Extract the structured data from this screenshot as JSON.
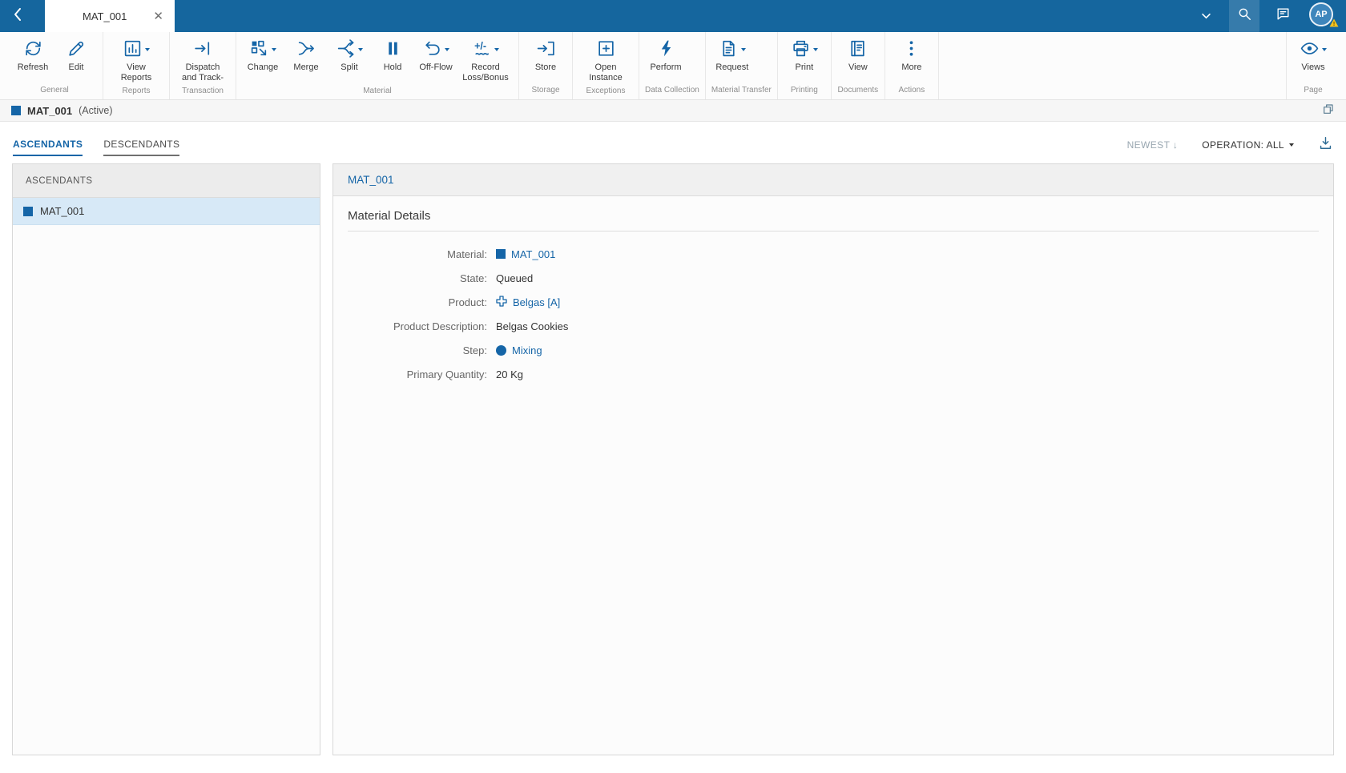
{
  "colors": {
    "topbar": "#15669E",
    "accent": "#1565A7",
    "selected_row": "#D7E9F7",
    "warning_badge": "#F6C21E"
  },
  "topbar": {
    "tab": {
      "title": "MAT_001"
    },
    "avatar": {
      "initials": "AP"
    }
  },
  "toolbar": {
    "groups": [
      {
        "label": "General",
        "buttons": [
          {
            "label": "Refresh",
            "icon": "refresh-icon",
            "dropdown": false
          },
          {
            "label": "Edit",
            "icon": "edit-pencil-icon",
            "dropdown": false
          }
        ]
      },
      {
        "label": "Reports",
        "buttons": [
          {
            "label": "View Reports",
            "icon": "report-chart-icon",
            "dropdown": true
          }
        ]
      },
      {
        "label": "Transaction",
        "buttons": [
          {
            "label": "Dispatch and Track-",
            "icon": "dispatch-arrow-icon",
            "dropdown": false
          }
        ]
      },
      {
        "label": "Material",
        "buttons": [
          {
            "label": "Change",
            "icon": "change-icon",
            "dropdown": true
          },
          {
            "label": "Merge",
            "icon": "merge-icon",
            "dropdown": false
          },
          {
            "label": "Split",
            "icon": "split-icon",
            "dropdown": true
          },
          {
            "label": "Hold",
            "icon": "hold-pause-icon",
            "dropdown": false
          },
          {
            "label": "Off-Flow",
            "icon": "off-flow-undo-icon",
            "dropdown": true
          },
          {
            "label": "Record Loss/Bonus",
            "icon": "loss-bonus-icon",
            "dropdown": true
          }
        ]
      },
      {
        "label": "Storage",
        "buttons": [
          {
            "label": "Store",
            "icon": "store-icon",
            "dropdown": false
          }
        ]
      },
      {
        "label": "Exceptions",
        "buttons": [
          {
            "label": "Open Instance",
            "icon": "open-instance-icon",
            "dropdown": false
          }
        ]
      },
      {
        "label": "Data Collection",
        "buttons": [
          {
            "label": "Perform",
            "icon": "perform-lightning-icon",
            "dropdown": false
          }
        ]
      },
      {
        "label": "Material Transfer",
        "buttons": [
          {
            "label": "Request",
            "icon": "request-document-icon",
            "dropdown": true
          }
        ]
      },
      {
        "label": "Printing",
        "buttons": [
          {
            "label": "Print",
            "icon": "print-icon",
            "dropdown": true
          }
        ]
      },
      {
        "label": "Documents",
        "buttons": [
          {
            "label": "View",
            "icon": "view-documents-icon",
            "dropdown": false
          }
        ]
      },
      {
        "label": "Actions",
        "buttons": [
          {
            "label": "More",
            "icon": "more-ellipsis-icon",
            "dropdown": false
          }
        ]
      },
      {
        "label": "Page",
        "buttons": [
          {
            "label": "Views",
            "icon": "views-eye-icon",
            "dropdown": true
          }
        ]
      }
    ]
  },
  "title_bar": {
    "name": "MAT_001",
    "status": "(Active)"
  },
  "view_tabs": {
    "tabs": [
      {
        "label": "ASCENDANTS",
        "active": true
      },
      {
        "label": "DESCENDANTS",
        "active": false
      }
    ],
    "sort_label": "NEWEST",
    "sort_direction": "↓",
    "operation_filter": "OPERATION: ALL"
  },
  "ascendants_panel": {
    "header": "ASCENDANTS",
    "items": [
      {
        "label": "MAT_001",
        "selected": true
      }
    ]
  },
  "detail_panel": {
    "header": "MAT_001",
    "section_title": "Material Details",
    "fields": [
      {
        "label": "Material:",
        "value": "MAT_001",
        "kind": "material-link"
      },
      {
        "label": "State:",
        "value": "Queued",
        "kind": "text"
      },
      {
        "label": "Product:",
        "value": "Belgas [A]",
        "kind": "product-link"
      },
      {
        "label": "Product Description:",
        "value": "Belgas Cookies",
        "kind": "text"
      },
      {
        "label": "Step:",
        "value": "Mixing",
        "kind": "step-link"
      },
      {
        "label": "Primary Quantity:",
        "value": "20 Kg",
        "kind": "text"
      }
    ]
  }
}
